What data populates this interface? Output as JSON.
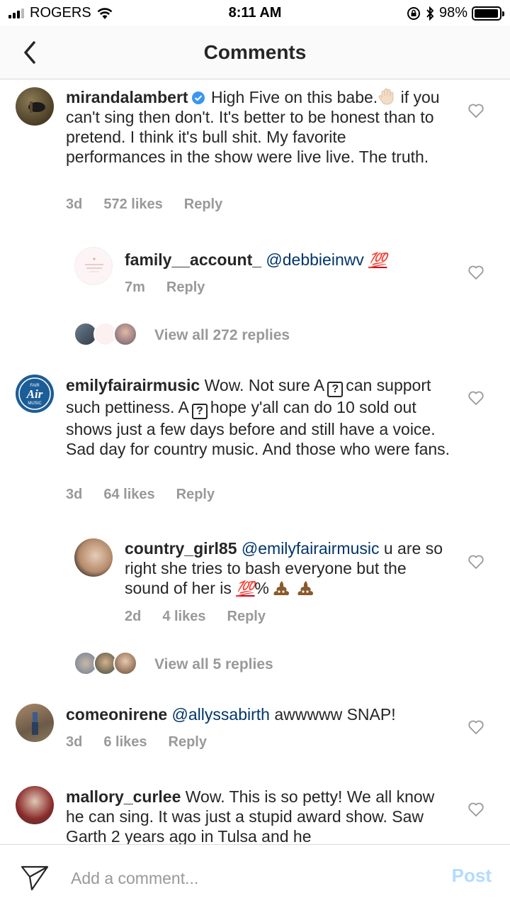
{
  "status_bar": {
    "carrier": "ROGERS",
    "time": "8:11 AM",
    "battery": "98%",
    "battery_level": 0.98
  },
  "header": {
    "title": "Comments",
    "back_icon": "chevron-left-icon"
  },
  "comments": [
    {
      "user": "mirandalambert",
      "verified": true,
      "text_1": "High Five on this babe.",
      "text_2": "if you can't sing then don't. It's better to be honest than to pretend.  I think it's bull shit. My favorite  performances in the show were live live. The truth.",
      "time": "3d",
      "likes": "572 likes",
      "reply": "Reply"
    },
    {
      "user": "family__account_",
      "mention": "@debbieinwv",
      "emoji": "💯",
      "time": "7m",
      "reply": "Reply"
    },
    {
      "view_replies": "View all 272 replies"
    },
    {
      "user": "emilyfairairmusic",
      "text_1": "Wow. Not sure A",
      "unknown_glyph": "?",
      "text_2": "can support such pettiness. A",
      "text_3": "hope y'all can do 10 sold out shows just a few days before and still have a voice. Sad day for country music. And those who were fans.",
      "time": "3d",
      "likes": "64 likes",
      "reply": "Reply",
      "avatar_text": "Air",
      "avatar_sub_top": "FAIR",
      "avatar_sub_bottom": "MUSIC"
    },
    {
      "user": "country_girl85",
      "mention": "@emilyfairairmusic",
      "text_1": "u are so right she tries to bash everyone but the sound of her is",
      "emoji": "💯",
      "text_2": "%",
      "time": "2d",
      "likes": "4 likes",
      "reply": "Reply"
    },
    {
      "view_replies": "View all 5 replies"
    },
    {
      "user": "comeonirene",
      "mention": "@allyssabirth",
      "text_1": "awwwww SNAP!",
      "time": "3d",
      "likes": "6 likes",
      "reply": "Reply"
    },
    {
      "user": "mallory_curlee",
      "text_1": "Wow. This is so petty! We all know he can sing. It was just a stupid award show. Saw Garth 2 years ago in Tulsa and he"
    }
  ],
  "composer": {
    "placeholder": "Add a comment...",
    "post_label": "Post"
  },
  "colors": {
    "text": "#262626",
    "muted": "#999999",
    "mention": "#003569",
    "post_disabled": "#b3dbff",
    "divider": "#dbdbdb"
  }
}
